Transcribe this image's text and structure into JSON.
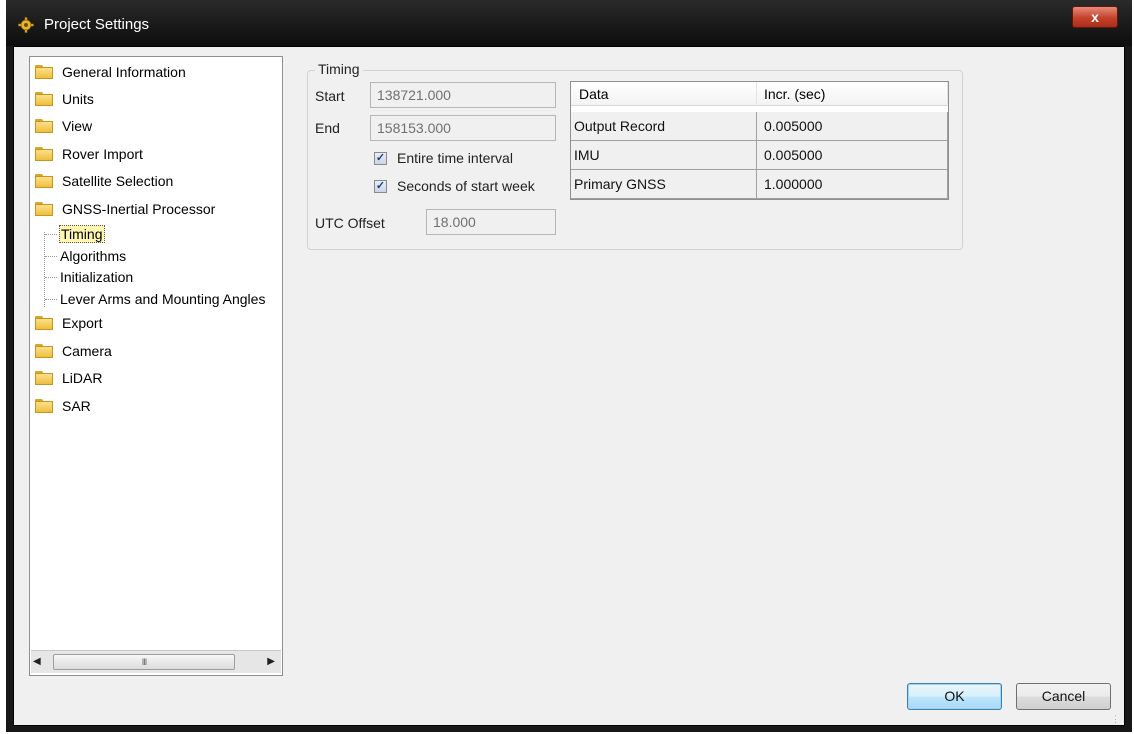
{
  "window": {
    "title": "Project Settings",
    "close_label": "x"
  },
  "tree": {
    "items_top": [
      {
        "label": "General Information"
      },
      {
        "label": "Units"
      },
      {
        "label": "View"
      },
      {
        "label": "Rover Import"
      },
      {
        "label": "Satellite Selection"
      },
      {
        "label": "GNSS-Inertial Processor"
      }
    ],
    "children": [
      {
        "label": "Timing",
        "selected": true
      },
      {
        "label": "Algorithms"
      },
      {
        "label": "Initialization"
      },
      {
        "label": "Lever Arms and Mounting Angles"
      }
    ],
    "items_bottom": [
      {
        "label": "Export"
      },
      {
        "label": "Camera"
      },
      {
        "label": "LiDAR"
      },
      {
        "label": "SAR"
      }
    ],
    "scrollbar": {
      "thumb_grip": "III"
    }
  },
  "timing": {
    "group_label": "Timing",
    "start_label": "Start",
    "start_value": "138721.000",
    "end_label": "End",
    "end_value": "158153.000",
    "entire_interval_label": "Entire time interval",
    "entire_interval_checked": true,
    "seconds_start_week_label": "Seconds of start week",
    "seconds_start_week_checked": true,
    "utc_offset_label": "UTC Offset",
    "utc_offset_value": "18.000"
  },
  "data_table": {
    "columns": [
      "Data",
      "Incr. (sec)"
    ],
    "rows": [
      {
        "data": "Output Record",
        "incr": "0.005000"
      },
      {
        "data": "IMU",
        "incr": "0.005000"
      },
      {
        "data": "Primary GNSS",
        "incr": "1.000000"
      }
    ]
  },
  "buttons": {
    "ok_label": "OK",
    "cancel_label": "Cancel"
  },
  "icons": {
    "app": "gear-icon",
    "folder": "folder-icon",
    "scroll_left": "arrow-left-icon",
    "scroll_right": "arrow-right-icon"
  },
  "colors": {
    "title_bar": "#111111",
    "close_button": "#c4412b",
    "folder": "#eebf3d",
    "selection": "#fff6b0",
    "ok_button": "#bee6fd"
  }
}
